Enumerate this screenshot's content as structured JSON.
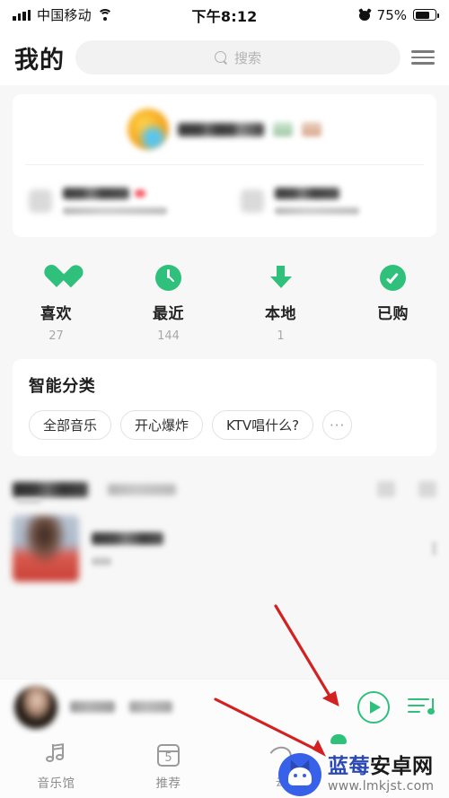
{
  "status_bar": {
    "carrier": "中国移动",
    "time": "下午8:12",
    "battery_percent": "75%",
    "battery_level": 75,
    "signal_icon": "signal-bars-icon",
    "wifi_icon": "wifi-icon",
    "alarm_icon": "alarm-clock-icon",
    "battery_icon": "battery-icon"
  },
  "header": {
    "title": "我的",
    "search_placeholder": "搜索",
    "search_value": "",
    "search_icon": "search-icon",
    "menu_icon": "hamburger-menu-icon"
  },
  "profile_card": {
    "avatar": "user-avatar-blurred",
    "username": "",
    "badges": [
      "badge-green",
      "badge-orange"
    ],
    "promos": [
      {
        "icon": "promo-icon-1",
        "title": "",
        "subtitle": "",
        "has_red_dot": true
      },
      {
        "icon": "promo-icon-2",
        "title": "",
        "subtitle": "",
        "has_red_dot": false
      }
    ]
  },
  "shortcuts": [
    {
      "icon": "heart-icon",
      "label": "喜欢",
      "count": "27"
    },
    {
      "icon": "clock-icon",
      "label": "最近",
      "count": "144"
    },
    {
      "icon": "download-arrow-icon",
      "label": "本地",
      "count": "1"
    },
    {
      "icon": "check-circle-icon",
      "label": "已购",
      "count": ""
    }
  ],
  "smart_category": {
    "title": "智能分类",
    "chips": [
      "全部音乐",
      "开心爆炸",
      "KTV唱什么?"
    ],
    "more_label": "···"
  },
  "list_section": {
    "tabs": [
      "",
      ""
    ],
    "header_icons": [
      "grid-view-icon",
      "list-view-icon"
    ],
    "items": [
      {
        "thumbnail": "playlist-cover-blurred",
        "title": "",
        "subtitle": "",
        "more_icon": "more-vertical-icon"
      }
    ]
  },
  "mini_player": {
    "cover": "album-art-blurred",
    "song_title": "",
    "artist": "",
    "play_icon": "play-circle-icon",
    "queue_icon": "playlist-queue-icon"
  },
  "tab_bar": [
    {
      "icon": "music-note-icon",
      "label": "音乐馆",
      "active": false
    },
    {
      "icon": "calendar-icon",
      "label": "推荐",
      "badge": "5",
      "active": false
    },
    {
      "icon": "cloud-arc-icon",
      "label": "云",
      "active": false
    },
    {
      "icon": "profile-icon",
      "label": "",
      "active": true
    }
  ],
  "watermark": {
    "title_blue": "蓝莓",
    "title_dark": "安卓网",
    "url": "www.lmkjst.com",
    "logo_icon": "android-mascot-logo"
  },
  "annotations": {
    "arrows": [
      {
        "name": "arrow-to-play-button",
        "color": "#d32020"
      },
      {
        "name": "arrow-to-tab-bar",
        "color": "#d32020"
      }
    ]
  },
  "colors": {
    "accent_green": "#2fc17c",
    "background": "#f7f7f7",
    "card": "#ffffff",
    "annotation_red": "#d32020",
    "watermark_blue": "#2b49b5"
  }
}
